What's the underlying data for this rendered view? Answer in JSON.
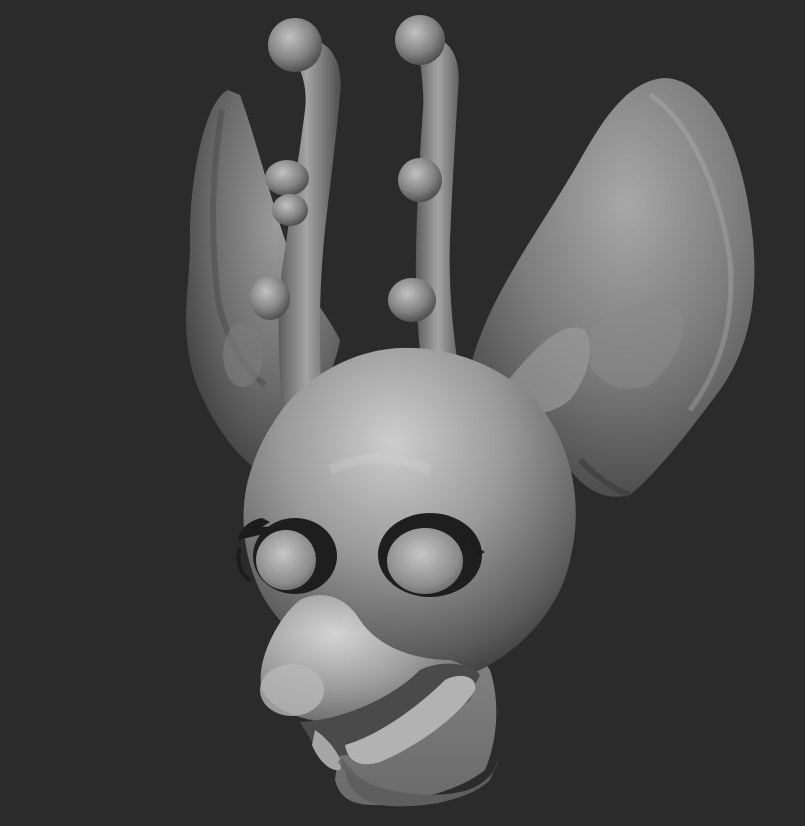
{
  "scene": {
    "subject": "sculpted-creature-head",
    "colors": {
      "background": "#2b2b2b",
      "clay_light": "#c9c9c9",
      "clay_mid": "#8f8f8f",
      "clay_dark": "#4a4a4a",
      "clay_shadow": "#1c1c1c"
    }
  }
}
